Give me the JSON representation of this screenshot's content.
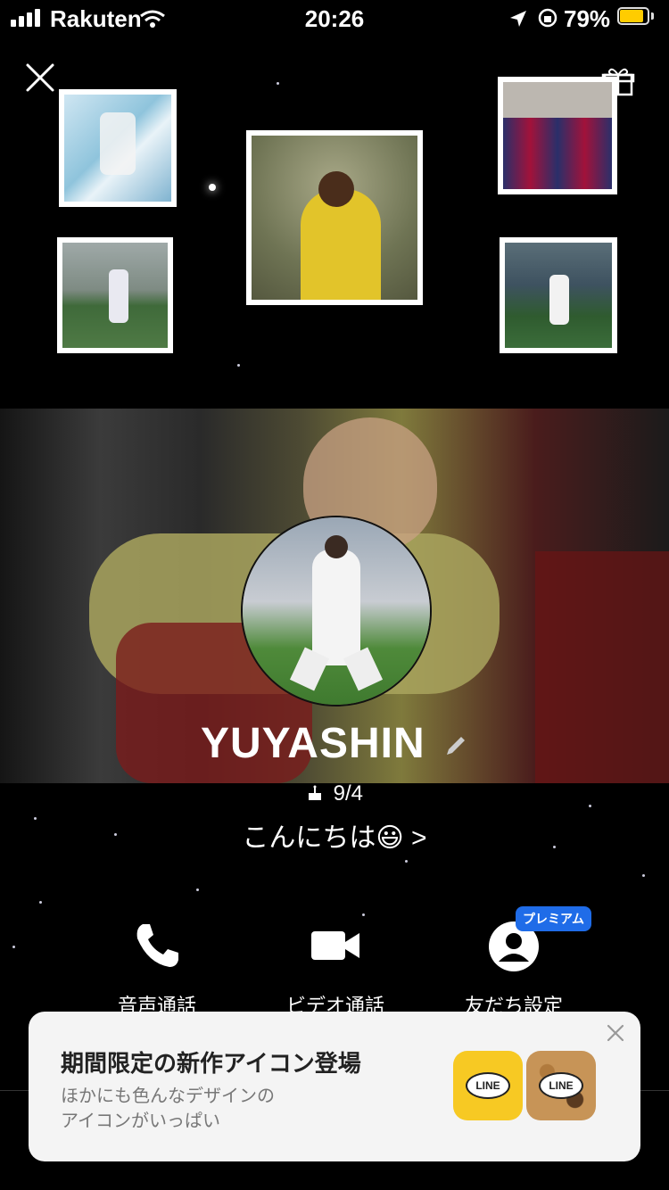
{
  "status_bar": {
    "carrier": "Rakuten",
    "time": "20:26",
    "battery": "79%",
    "battery_level": 0.79
  },
  "header": {
    "close_icon": "close-icon",
    "gift_icon": "gift-icon"
  },
  "profile": {
    "name": "YUYASHIN",
    "birthday": "9/4",
    "status_message": "こんにちは😃 >"
  },
  "actions": [
    {
      "label": "音声通話",
      "icon": "phone-icon"
    },
    {
      "label": "ビデオ通話",
      "icon": "video-camera-icon"
    },
    {
      "label": "友だち設定",
      "icon": "friend-settings-icon",
      "badge": "プレミアム"
    }
  ],
  "banner": {
    "title": "期間限定の新作アイコン登場",
    "subtitle_line1": "ほかにも色んなデザインの",
    "subtitle_line2": "アイコンがいっぱい",
    "icon_text_1": "LINE",
    "icon_text_2": "LINE"
  },
  "colors": {
    "background": "#000000",
    "premium_badge": "#1f6ce8",
    "banner_bg": "#f4f4f4",
    "battery": "#ffcc00"
  }
}
